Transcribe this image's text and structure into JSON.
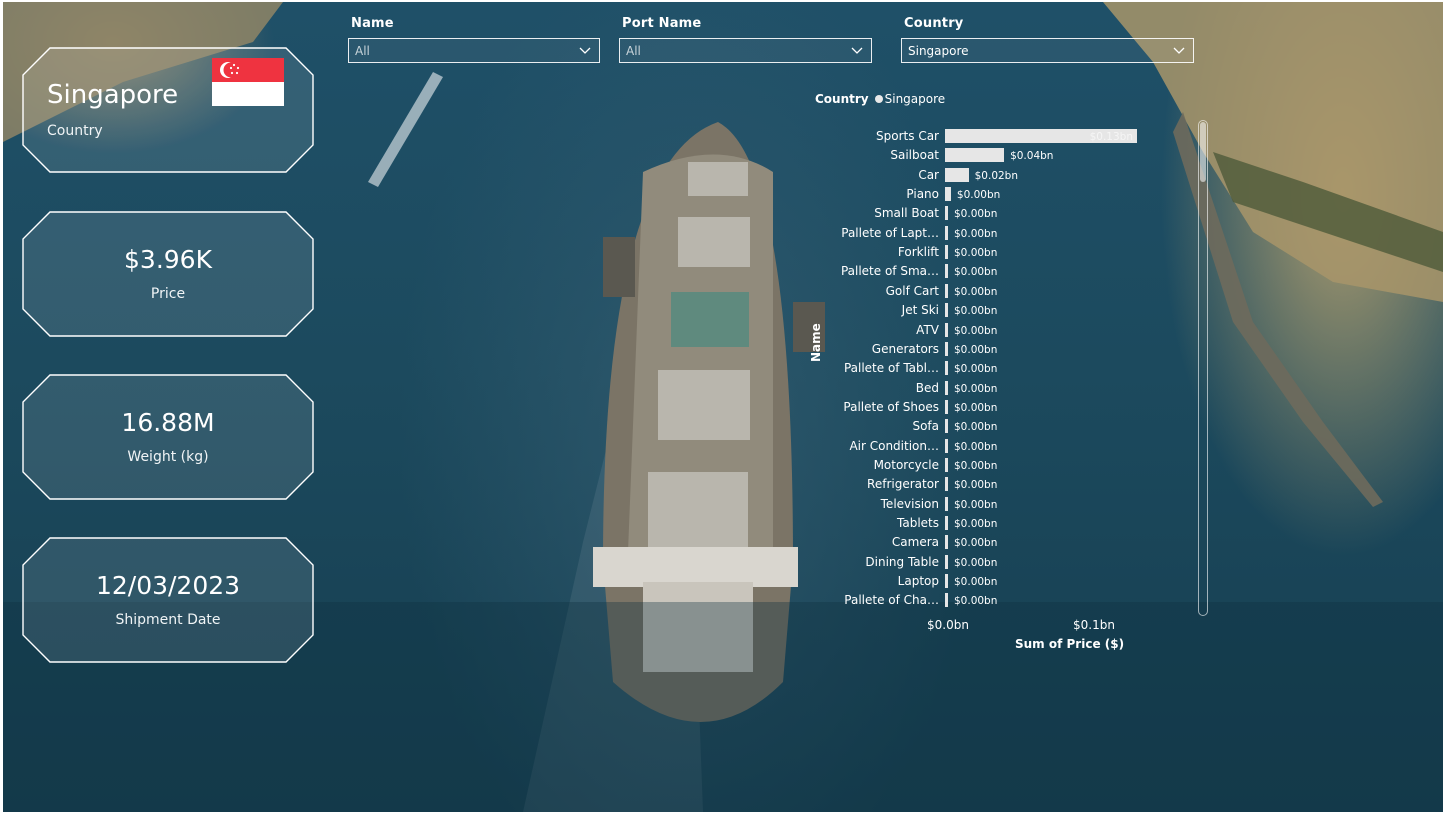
{
  "filters": [
    {
      "title": "Name",
      "value": "All"
    },
    {
      "title": "Port Name",
      "value": "All"
    },
    {
      "title": "Country",
      "value": "Singapore"
    }
  ],
  "cards": {
    "country": {
      "value": "Singapore",
      "label": "Country",
      "flag": "singapore-flag"
    },
    "price": {
      "value": "$3.96K",
      "label": "Price"
    },
    "weight": {
      "value": "16.88M",
      "label": "Weight (kg)"
    },
    "date": {
      "value": "12/03/2023",
      "label": "Shipment Date"
    }
  },
  "colors": {
    "bar": "#e6e6e6",
    "flag_red": "#ef3340",
    "flag_white": "#ffffff"
  },
  "chart_data": {
    "type": "bar",
    "orientation": "horizontal",
    "legend": {
      "title": "Country",
      "items": [
        "Singapore"
      ],
      "placement": "top-left"
    },
    "ylabel": "Name",
    "xlabel": "Sum of Price ($)",
    "x_ticks": [
      "$0.0bn",
      "$0.1bn"
    ],
    "xlim": [
      0,
      0.13
    ],
    "categories": [
      "Sports Car",
      "Sailboat",
      "Car",
      "Piano",
      "Small Boat",
      "Pallete of Lapt…",
      "Forklift",
      "Pallete of Sma…",
      "Golf Cart",
      "Jet Ski",
      "ATV",
      "Generators",
      "Pallete of Tabl…",
      "Bed",
      "Pallete of Shoes",
      "Sofa",
      "Air Condition…",
      "Motorcycle",
      "Refrigerator",
      "Television",
      "Tablets",
      "Camera",
      "Dining Table",
      "Laptop",
      "Pallete of Cha…"
    ],
    "values": [
      0.13,
      0.04,
      0.016,
      0.004,
      0.002,
      0.002,
      0.001,
      0.001,
      0.001,
      0.001,
      0.001,
      0.001,
      0.001,
      0.001,
      0.001,
      0.001,
      0.001,
      0.001,
      0.001,
      0.001,
      0.001,
      0.001,
      0.001,
      0.001,
      0.001
    ],
    "data_labels": [
      "$0.13bn",
      "$0.04bn",
      "$0.02bn",
      "$0.00bn",
      "$0.00bn",
      "$0.00bn",
      "$0.00bn",
      "$0.00bn",
      "$0.00bn",
      "$0.00bn",
      "$0.00bn",
      "$0.00bn",
      "$0.00bn",
      "$0.00bn",
      "$0.00bn",
      "$0.00bn",
      "$0.00bn",
      "$0.00bn",
      "$0.00bn",
      "$0.00bn",
      "$0.00bn",
      "$0.00bn",
      "$0.00bn",
      "$0.00bn",
      "$0.00bn"
    ],
    "grid": false
  }
}
